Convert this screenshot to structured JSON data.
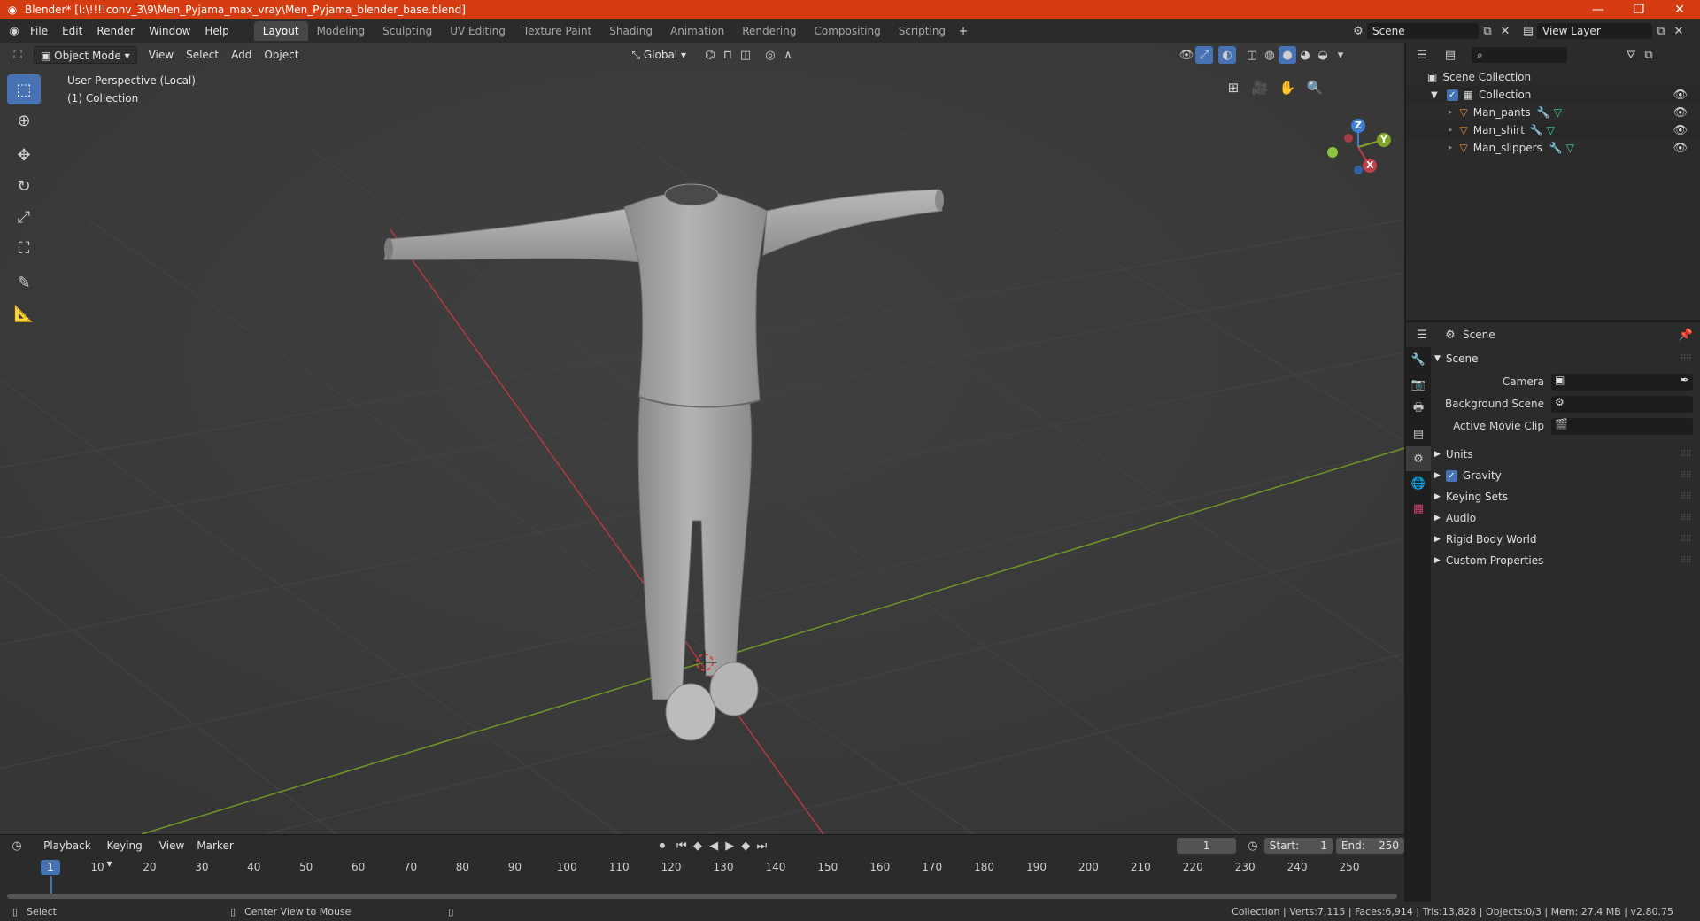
{
  "window": {
    "title": "Blender* [I:\\!!!!conv_3\\9\\Men_Pyjama_max_vray\\Men_Pyjama_blender_base.blend]",
    "minimize": "—",
    "maximize": "❐",
    "close": "✕"
  },
  "menu": [
    "File",
    "Edit",
    "Render",
    "Window",
    "Help"
  ],
  "workspaces": [
    "Layout",
    "Modeling",
    "Sculpting",
    "UV Editing",
    "Texture Paint",
    "Shading",
    "Animation",
    "Rendering",
    "Compositing",
    "Scripting"
  ],
  "active_workspace": "Layout",
  "scene_selector": "Scene",
  "view_layer_selector": "View Layer",
  "viewport": {
    "mode": "Object Mode",
    "menus": [
      "View",
      "Select",
      "Add",
      "Object"
    ],
    "transform_orientation": "Global",
    "perspective_label": "User Perspective (Local)",
    "collection_label": "(1) Collection",
    "gizmo": {
      "z": "Z",
      "y": "Y",
      "x": "X"
    }
  },
  "outliner": {
    "root": "Scene Collection",
    "collection": "Collection",
    "objects": [
      "Man_pants",
      "Man_shirt",
      "Man_slippers"
    ]
  },
  "properties": {
    "context": "Scene",
    "panel_title": "Scene",
    "fields": [
      "Camera",
      "Background Scene",
      "Active Movie Clip"
    ],
    "sections": [
      "Units",
      "Gravity",
      "Keying Sets",
      "Audio",
      "Rigid Body World",
      "Custom Properties"
    ]
  },
  "timeline": {
    "menus": [
      "Playback",
      "Keying",
      "View",
      "Marker"
    ],
    "current_frame": "1",
    "start_label": "Start:",
    "start": "1",
    "end_label": "End:",
    "end": "250",
    "ticks": [
      "10",
      "20",
      "30",
      "40",
      "50",
      "60",
      "70",
      "80",
      "90",
      "100",
      "110",
      "120",
      "130",
      "140",
      "150",
      "160",
      "170",
      "180",
      "190",
      "200",
      "210",
      "220",
      "230",
      "240",
      "250"
    ],
    "ruler_current": "1"
  },
  "statusbar": {
    "left": "Select",
    "middle": "Center View to Mouse",
    "right": "Collection | Verts:7,115 | Faces:6,914 | Tris:13,828 | Objects:0/3 | Mem: 27.4 MB | v2.80.75"
  },
  "colors": {
    "title_bar": "#d63c12",
    "accent": "#4772b3",
    "viewport_bg": "#3a3a3a",
    "x_axis": "#c0404a",
    "y_axis": "#7ea32a",
    "z_axis": "#3d7fd6"
  }
}
